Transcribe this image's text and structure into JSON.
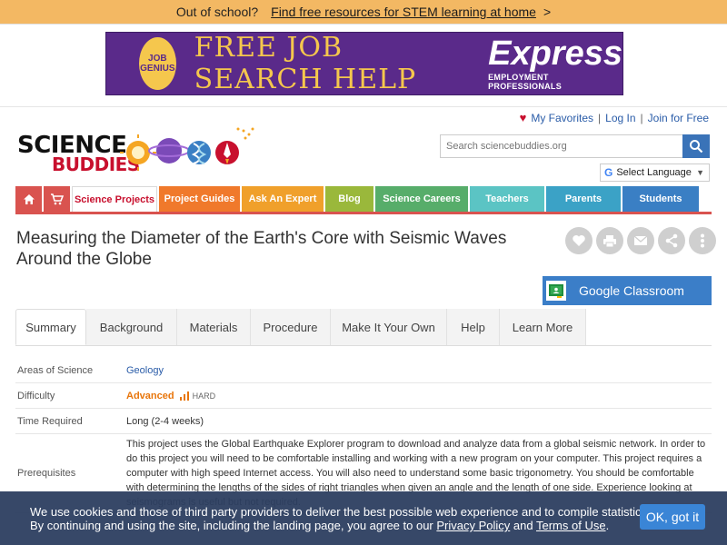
{
  "promo": {
    "question": "Out of school?",
    "link": "Find free resources for STEM learning at home",
    "arrow": ">"
  },
  "ad": {
    "badge_line1": "JOB",
    "badge_line2": "GENIUS",
    "headline": "FREE JOB SEARCH HELP",
    "brand": "Express",
    "brand_sub": "EMPLOYMENT PROFESSIONALS"
  },
  "account": {
    "favorites": "My Favorites",
    "login": "Log In",
    "join": "Join for Free",
    "sep": "|"
  },
  "logo": {
    "line1": "SCIENCE",
    "line2": "BUDDIES"
  },
  "search": {
    "placeholder": "Search sciencebuddies.org"
  },
  "language": {
    "label": "Select Language"
  },
  "nav": {
    "items": [
      {
        "label": "Science Projects",
        "color": "#ffffff"
      },
      {
        "label": "Project Guides",
        "color": "#f0792b"
      },
      {
        "label": "Ask An Expert",
        "color": "#f0a02b"
      },
      {
        "label": "Blog",
        "color": "#9ab83b"
      },
      {
        "label": "Science Careers",
        "color": "#57ad6a"
      },
      {
        "label": "Teachers",
        "color": "#5bc4c4"
      },
      {
        "label": "Parents",
        "color": "#3ba2c6"
      },
      {
        "label": "Students",
        "color": "#3a7fc4"
      }
    ]
  },
  "page": {
    "title": "Measuring the Diameter of the Earth's Core with Seismic Waves Around the Globe",
    "classroom": "Google Classroom"
  },
  "tabs": [
    "Summary",
    "Background",
    "Materials",
    "Procedure",
    "Make It Your Own",
    "Help",
    "Learn More"
  ],
  "info": {
    "areas_label": "Areas of Science",
    "areas_value": "Geology",
    "difficulty_label": "Difficulty",
    "difficulty_level": "Advanced",
    "difficulty_hard": "HARD",
    "time_label": "Time Required",
    "time_value": "Long (2-4 weeks)",
    "prereq_label": "Prerequisites",
    "prereq_value": "This project uses the Global Earthquake Explorer program to download and analyze data from a global seismic network. In order to do this project you will need to be comfortable installing and working with a new program on your computer. This project requires a computer with high speed Internet access. You will also need to understand some basic trigonometry. You should be comfortable with determining the lengths of the sides of right triangles when given an angle and the length of one side. Experience looking at seismograms is useful but not required."
  },
  "cookie": {
    "line1": "We use cookies and those of third party providers to deliver the best possible web experience and to compile statistics.",
    "line2_pre": "By continuing and using the site, including the landing page, you agree to our ",
    "privacy": "Privacy Policy",
    "and": " and ",
    "terms": "Terms of Use",
    "period": ".",
    "ok": "OK, got it"
  }
}
